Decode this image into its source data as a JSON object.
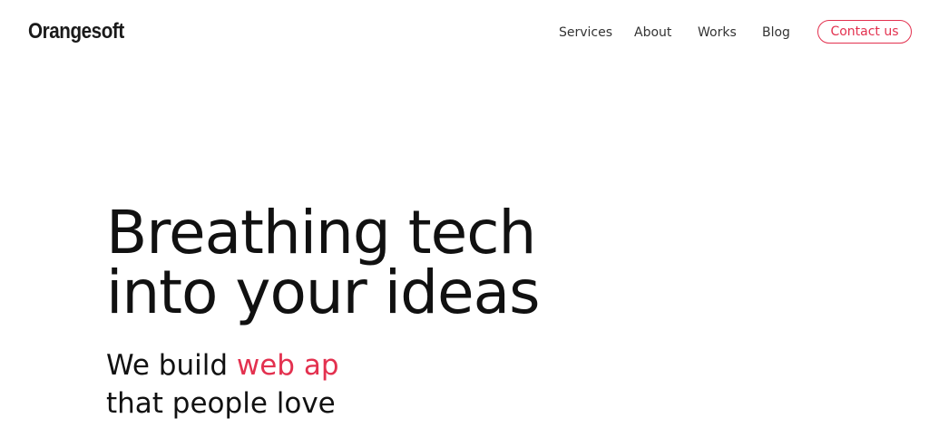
{
  "brand": {
    "logo_text": "Orangesoft"
  },
  "nav": {
    "items": [
      {
        "label": "Services"
      },
      {
        "label": "About"
      },
      {
        "label": "Works"
      },
      {
        "label": "Blog"
      }
    ],
    "contact_label": "Contact us"
  },
  "hero": {
    "title_line1": "Breathing tech",
    "title_line2": "into your ideas",
    "subtitle_prefix": "We build ",
    "subtitle_highlight": "web ap",
    "subtitle_line2": "that people love"
  },
  "colors": {
    "accent": "#e3314f",
    "text": "#111111",
    "background": "#ffffff"
  }
}
